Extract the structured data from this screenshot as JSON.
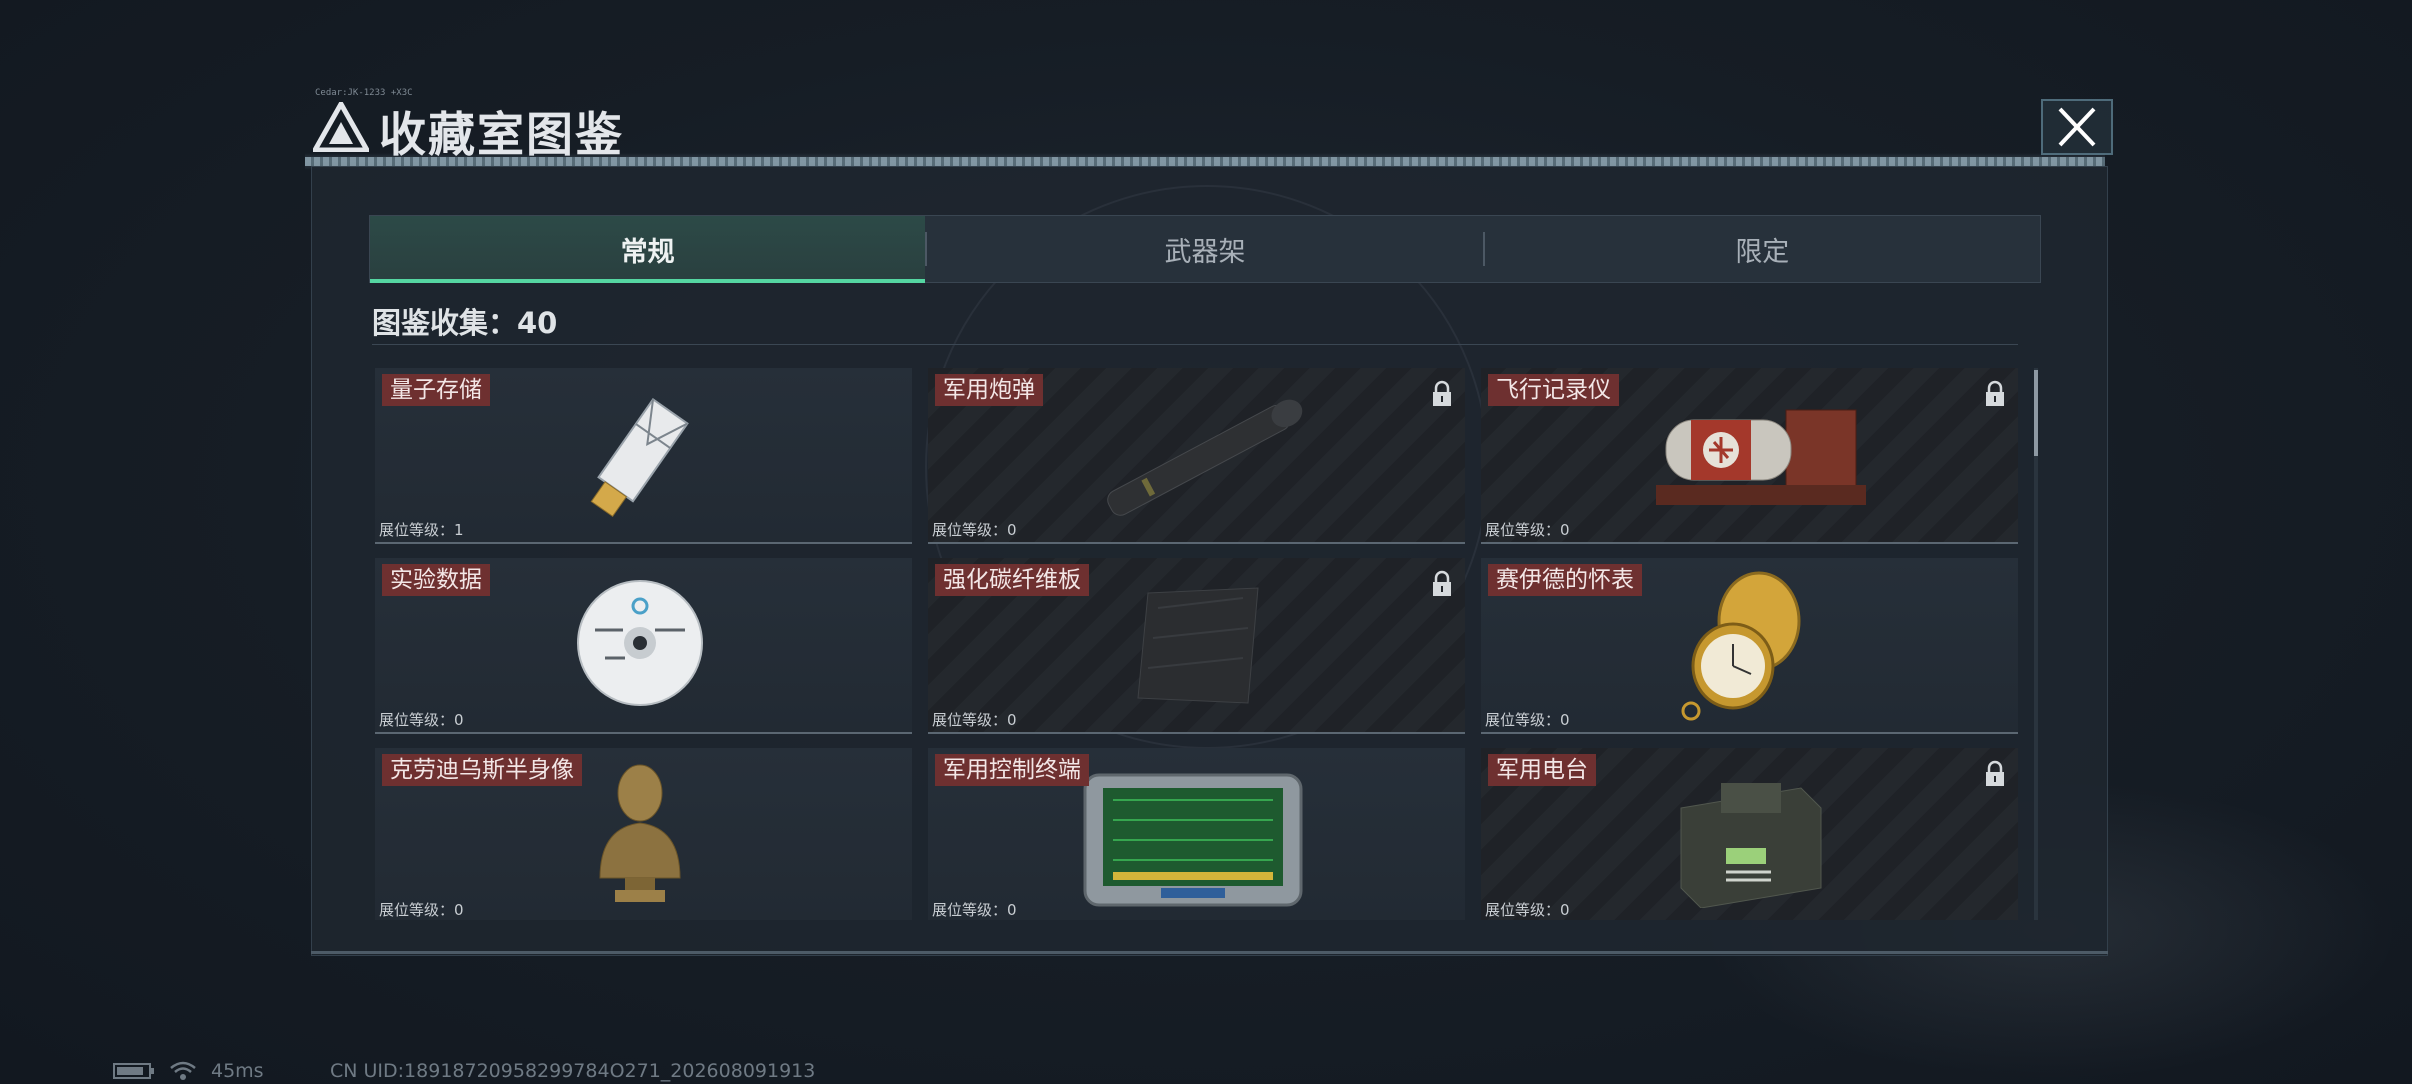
{
  "header": {
    "title": "收藏室图鉴",
    "code": "Cedar:JK-1233 +X3C"
  },
  "tabs": [
    {
      "label": "常规",
      "active": true
    },
    {
      "label": "武器架",
      "active": false
    },
    {
      "label": "限定",
      "active": false
    }
  ],
  "collection": {
    "label": "图鉴收集：40"
  },
  "items": [
    {
      "name": "量子存储",
      "level": "展位等级：1",
      "locked": false,
      "icon": "usb-drive-icon"
    },
    {
      "name": "军用炮弹",
      "level": "展位等级：0",
      "locked": true,
      "icon": "artillery-shell-icon"
    },
    {
      "name": "飞行记录仪",
      "level": "展位等级：0",
      "locked": true,
      "icon": "flight-recorder-icon"
    },
    {
      "name": "实验数据",
      "level": "展位等级：0",
      "locked": false,
      "icon": "disc-icon"
    },
    {
      "name": "强化碳纤维板",
      "level": "展位等级：0",
      "locked": true,
      "icon": "carbon-plate-icon"
    },
    {
      "name": "赛伊德的怀表",
      "level": "展位等级：0",
      "locked": false,
      "icon": "pocket-watch-icon"
    },
    {
      "name": "克劳迪乌斯半身像",
      "level": "展位等级：0",
      "locked": false,
      "icon": "bust-icon"
    },
    {
      "name": "军用控制终端",
      "level": "展位等级：0",
      "locked": false,
      "icon": "control-terminal-icon"
    },
    {
      "name": "军用电台",
      "level": "展位等级：0",
      "locked": true,
      "icon": "radio-icon"
    }
  ],
  "footer": {
    "ping": "45ms",
    "uid": "CN UID:18918720958299784O271_202608091913"
  },
  "colors": {
    "accent": "#55d6a2",
    "name_tag": "#6e3030",
    "panel": "#1e262f"
  }
}
